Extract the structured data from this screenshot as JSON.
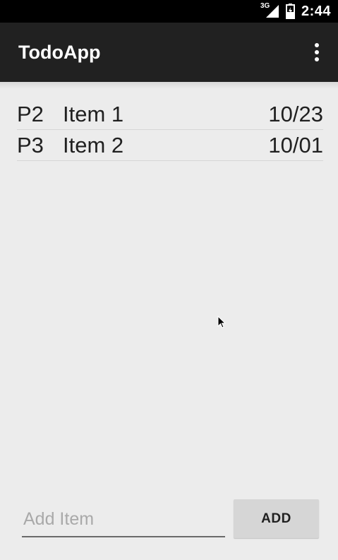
{
  "status_bar": {
    "network": "3G",
    "time": "2:44",
    "icons": [
      "signal-icon",
      "battery-icon"
    ]
  },
  "action_bar": {
    "title": "TodoApp",
    "menu_icon": "overflow-menu-icon"
  },
  "todo_list": {
    "items": [
      {
        "priority": "P2",
        "name": "Item 1",
        "date": "10/23"
      },
      {
        "priority": "P3",
        "name": "Item 2",
        "date": "10/01"
      }
    ]
  },
  "add_form": {
    "input_value": "",
    "input_placeholder": "Add Item",
    "button_label": "ADD"
  },
  "colors": {
    "status_bar": "#000000",
    "action_bar": "#212121",
    "background": "#ECECEC",
    "button": "#D6D6D6",
    "text": "#202020",
    "placeholder": "#A9A9A9"
  }
}
